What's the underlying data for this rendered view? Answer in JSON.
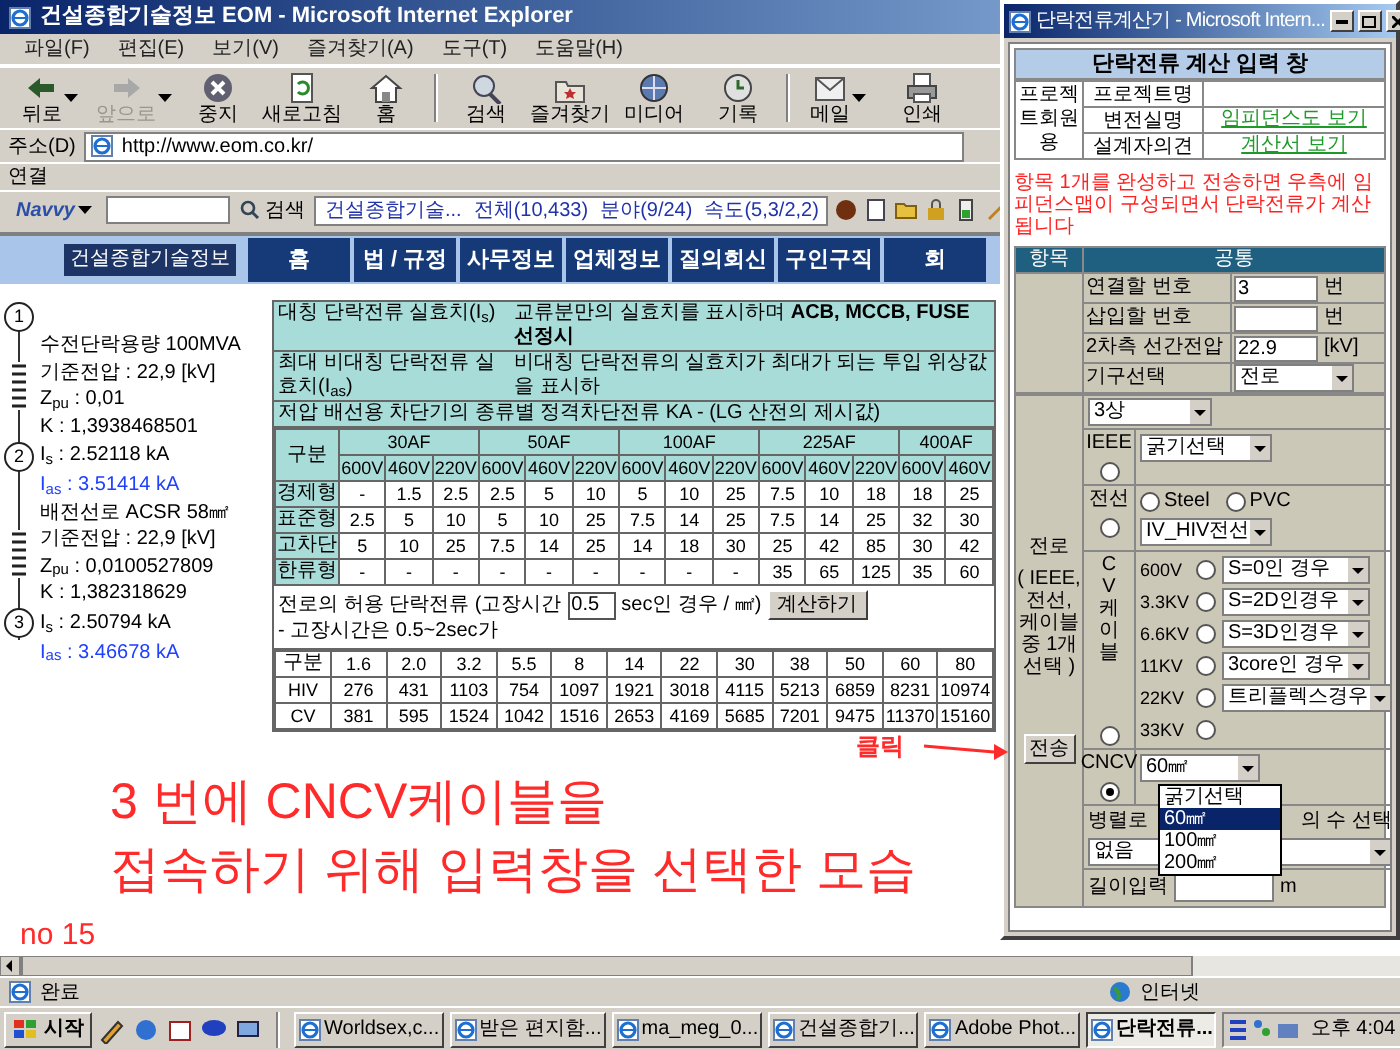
{
  "browser": {
    "title": "건설종합기술정보 EOM - Microsoft Internet Explorer",
    "menu": [
      "파일(F)",
      "편집(E)",
      "보기(V)",
      "즐겨찾기(A)",
      "도구(T)",
      "도움말(H)"
    ],
    "toolbar": [
      {
        "label": "뒤로",
        "disabled": false,
        "dropdown": true
      },
      {
        "label": "앞으로",
        "disabled": true,
        "dropdown": true
      },
      {
        "label": "중지",
        "disabled": false,
        "dropdown": false
      },
      {
        "label": "새로고침",
        "disabled": false,
        "dropdown": false
      },
      {
        "label": "홈",
        "disabled": false,
        "dropdown": false
      },
      {
        "label": "검색",
        "disabled": false,
        "dropdown": false
      },
      {
        "label": "즐겨찾기",
        "disabled": false,
        "dropdown": false
      },
      {
        "label": "미디어",
        "disabled": false,
        "dropdown": false
      },
      {
        "label": "기록",
        "disabled": false,
        "dropdown": false
      },
      {
        "label": "메일",
        "disabled": false,
        "dropdown": true
      },
      {
        "label": "인쇄",
        "disabled": false,
        "dropdown": false
      }
    ],
    "address_label": "주소(D)",
    "address": "http://www.eom.co.kr/",
    "links_label": "연결",
    "navvy": {
      "brand": "Navvy",
      "search_button": "검색",
      "results": "건설종합기술...",
      "stats": [
        "전체(10,433)",
        "분야(9/24)",
        "속도(5,3/2,2)"
      ]
    },
    "status": "완료",
    "zone": "인터넷"
  },
  "site": {
    "logo": "건설종합기술정보",
    "nav": [
      "홈",
      "법 / 규정",
      "사무정보",
      "업체정보",
      "질의회신",
      "구인구직",
      "회"
    ]
  },
  "diagram": [
    {
      "kind": "node",
      "number": "1"
    },
    {
      "kind": "impedance",
      "lines": [
        "수전단락용량 100MVA",
        "기준전압 : 22,9 [kV]",
        "Z$_{pu}$ : 0,01",
        "K : 1,3938468501"
      ]
    },
    {
      "kind": "node",
      "number": "2",
      "text": "I$_{s}$ : 2.52118 kA"
    },
    {
      "kind": "asym",
      "text": "I$_{as}$ : 3.51414 kA"
    },
    {
      "kind": "impedance",
      "lines": [
        "배전선로 ACSR 58㎟",
        "기준전압 : 22,9 [kV]",
        "Z$_{pu}$ : 0,0100527809",
        "K : 1,382318629"
      ]
    },
    {
      "kind": "node",
      "number": "3",
      "text": "I$_{s}$ : 2.50794 kA"
    },
    {
      "kind": "asym",
      "text": "I$_{as}$ : 3.46678 kA"
    }
  ],
  "info_rows": [
    {
      "term": "대칭 단락전류 실효치(I$_{s}$)",
      "desc": "교류분만의 실효치를 표시하며 **ACB, MCCB, FUSE 선정시**"
    },
    {
      "term": "최대 비대칭 단락전류 실효치(I$_{as}$)",
      "desc": "비대칭 단락전류의 실효치가 최대가 되는 투입 위상값을 표시하"
    }
  ],
  "breaker_table": {
    "title": "저압 배선용 차단기의 종류별 정격차단전류 KA - (LG 산전의 제시값)",
    "corner": "구분",
    "groups": [
      {
        "label": "30AF",
        "voltages": [
          "600V",
          "460V",
          "220V"
        ]
      },
      {
        "label": "50AF",
        "voltages": [
          "600V",
          "460V",
          "220V"
        ]
      },
      {
        "label": "100AF",
        "voltages": [
          "600V",
          "460V",
          "220V"
        ]
      },
      {
        "label": "225AF",
        "voltages": [
          "600V",
          "460V",
          "220V"
        ]
      },
      {
        "label": "400AF",
        "voltages": [
          "600V",
          "460V"
        ]
      }
    ],
    "rows": [
      {
        "label": "경제형",
        "values": [
          "-",
          "1.5",
          "2.5",
          "2.5",
          "5",
          "10",
          "5",
          "10",
          "25",
          "7.5",
          "10",
          "18",
          "18",
          "25"
        ]
      },
      {
        "label": "표준형",
        "values": [
          "2.5",
          "5",
          "10",
          "5",
          "10",
          "25",
          "7.5",
          "14",
          "25",
          "7.5",
          "14",
          "25",
          "32",
          "30"
        ]
      },
      {
        "label": "고차단",
        "values": [
          "5",
          "10",
          "25",
          "7.5",
          "14",
          "25",
          "14",
          "18",
          "30",
          "25",
          "42",
          "85",
          "30",
          "42"
        ]
      },
      {
        "label": "한류형",
        "values": [
          "-",
          "-",
          "-",
          "-",
          "-",
          "-",
          "-",
          "-",
          "-",
          "35",
          "65",
          "125",
          "35",
          "60"
        ]
      }
    ]
  },
  "allowable": {
    "label_before": "전로의 허용 단락전류 (고장시간",
    "time": "0.5",
    "label_after": "sec인 경우 / ㎟)",
    "button": "계산하기",
    "note": "- 고장시간은 0.5~2sec가",
    "columns": [
      "구분",
      "1.6",
      "2.0",
      "3.2",
      "5.5",
      "8",
      "14",
      "22",
      "30",
      "38",
      "50",
      "60",
      "80"
    ],
    "rows": [
      [
        "HIV",
        "276",
        "431",
        "1103",
        "754",
        "1097",
        "1921",
        "3018",
        "4115",
        "5213",
        "6859",
        "8231",
        "10974"
      ],
      [
        "CV",
        "381",
        "595",
        "1524",
        "1042",
        "1516",
        "2653",
        "4169",
        "5685",
        "7201",
        "9475",
        "11370",
        "15160"
      ]
    ]
  },
  "annotation": {
    "lines": [
      "3 번에 CNCV케이블을",
      "접속하기 위해 입력창을 선택한 모습"
    ],
    "page": "no 15",
    "click": "클릭"
  },
  "popup": {
    "title": "단락전류계산기 - Microsoft Intern...",
    "heading": "단락전류 계산 입력 창",
    "project": {
      "group": "프로젝트회원용",
      "rows": [
        {
          "label": "프로젝트명"
        },
        {
          "label": "변전실명",
          "link": "임피던스도 보기"
        },
        {
          "label": "설계자의견",
          "link": "계산서 보기"
        }
      ]
    },
    "notice": "항목 1개를 완성하고 전송하면 우측에 임피던스맵이 구성되면서 단락전류가 계산됩니다",
    "columns": [
      "항목",
      "공통"
    ],
    "fields": [
      {
        "kind": "text",
        "label": "연결할 번호",
        "value": "3",
        "unit": "번"
      },
      {
        "kind": "text",
        "label": "삽입할 번호",
        "unit": "번"
      },
      {
        "kind": "text",
        "label": "2차측 선간전압",
        "value": "22.9",
        "unit": "[kV]"
      },
      {
        "kind": "select",
        "label": "기구선택",
        "value": "전로"
      }
    ],
    "line": {
      "label": "전로",
      "hint": "( IEEE, 전선, 케이블 중 1개 선택 )",
      "submit": "전송",
      "phase": "3상",
      "options": [
        {
          "kind": "ieee",
          "label": "IEEE",
          "selected": false,
          "select": "굵기선택"
        },
        {
          "kind": "wire",
          "label": "전선",
          "selected": false,
          "materials": [
            {
              "label": "Steel",
              "selected": false
            },
            {
              "label": "PVC",
              "selected": false
            }
          ],
          "select": "IV_HIV전선"
        },
        {
          "kind": "cable",
          "label": "CV케이블",
          "selected": false,
          "voltages": [
            {
              "label": "600V",
              "selected": false,
              "select": "S=0인 경우"
            },
            {
              "label": "3.3KV",
              "selected": false,
              "select": "S=2D인경우"
            },
            {
              "label": "6.6KV",
              "selected": false,
              "select": "S=3D인경우"
            },
            {
              "label": "11KV",
              "selected": false,
              "select": "3core인 경우"
            },
            {
              "label": "22KV",
              "selected": false,
              "select": "트리플렉스경우"
            },
            {
              "label": "33KV",
              "selected": false
            }
          ]
        },
        {
          "kind": "cncv",
          "label": "CNCV",
          "selected": true,
          "select": "60㎟",
          "open": true,
          "choices": [
            {
              "label": "굵기선택",
              "selected": false
            },
            {
              "label": "60㎟",
              "selected": true
            },
            {
              "label": "100㎟",
              "selected": false
            },
            {
              "label": "200㎟",
              "selected": false
            }
          ]
        }
      ],
      "parallel": {
        "label": "병렬로",
        "label_after": "의 수 선택",
        "value": "없음"
      },
      "length": {
        "label": "길이입력",
        "unit": "m"
      }
    }
  },
  "taskbar": {
    "start": "시작",
    "tasks": [
      {
        "label": "Worldsex,c...",
        "selected": false
      },
      {
        "label": "받은 편지함...",
        "selected": false
      },
      {
        "label": "ma_meg_0...",
        "selected": false
      },
      {
        "label": "건설종합기...",
        "selected": false
      },
      {
        "label": "Adobe Phot...",
        "selected": false
      },
      {
        "label": "단락전류...",
        "selected": true
      }
    ],
    "clock": "오후 4:04"
  }
}
